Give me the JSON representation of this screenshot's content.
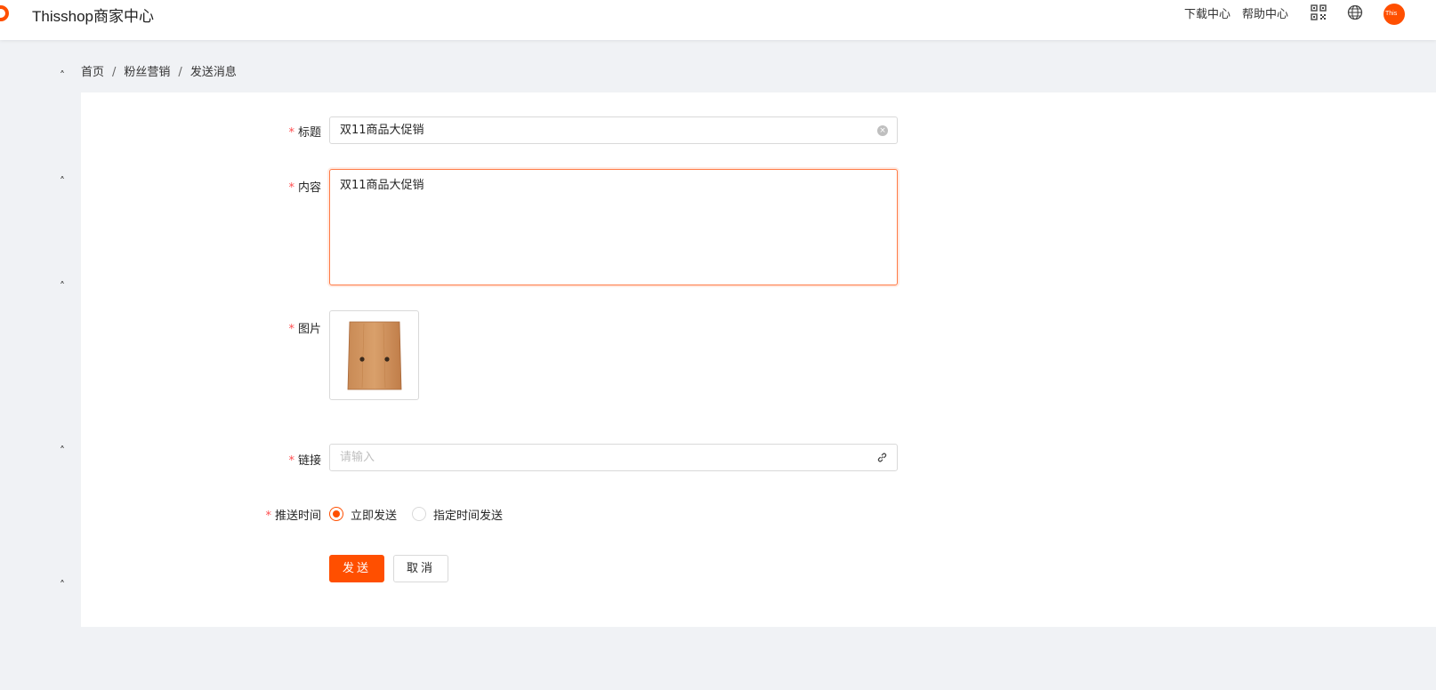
{
  "header": {
    "brand": "Thisshop商家中心",
    "download_center": "下载中心",
    "help_center": "帮助中心",
    "avatar_text": "This",
    "accent_color": "#ff4f00"
  },
  "breadcrumb": {
    "items": [
      "首页",
      "粉丝营销",
      "发送消息"
    ],
    "separator": "/"
  },
  "form": {
    "title": {
      "label": "标题",
      "required_mark": "*",
      "value": "双11商品大促销"
    },
    "content": {
      "label": "内容",
      "required_mark": "*",
      "value": "双11商品大促销"
    },
    "image": {
      "label": "图片",
      "required_mark": "*"
    },
    "link": {
      "label": "链接",
      "required_mark": "*",
      "placeholder": "请输入"
    },
    "push_time": {
      "label": "推送时间",
      "required_mark": "*",
      "options": [
        "立即发送",
        "指定时间发送"
      ],
      "selected": "立即发送"
    }
  },
  "actions": {
    "send": "发送",
    "cancel": "取消"
  },
  "caret_symbol": "˄"
}
